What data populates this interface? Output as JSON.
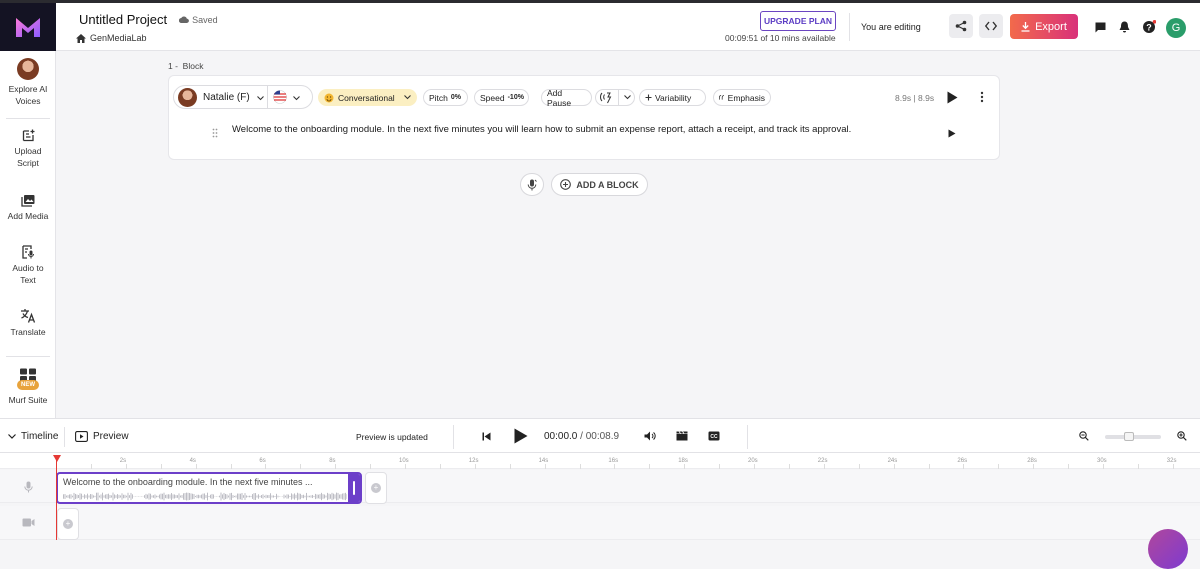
{
  "header": {
    "project_title": "Untitled Project",
    "saved_status": "Saved",
    "workspace": "GenMediaLab",
    "upgrade_label": "UPGRADE PLAN",
    "time_available": "00:09:51 of 10 mins available",
    "editing_status": "You are editing",
    "export_label": "Export",
    "user_initial": "G"
  },
  "sidebar": {
    "items": [
      {
        "label": "Explore AI Voices"
      },
      {
        "label": "Upload Script"
      },
      {
        "label": "Add Media"
      },
      {
        "label": "Audio to Text"
      },
      {
        "label": "Translate"
      },
      {
        "label": "Murf Suite",
        "badge": "NEW"
      }
    ]
  },
  "block": {
    "index": "1 -",
    "label": "Block",
    "voice": "Natalie (F)",
    "style": "Conversational",
    "pitch_label": "Pitch",
    "pitch_value": "0%",
    "speed_label": "Speed",
    "speed_value": "-10%",
    "add_pause": "Add Pause",
    "variability": "Variability",
    "emphasis": "Emphasis",
    "duration": "8.9s | 8.9s",
    "script_text": "Welcome to the onboarding module. In the next five minutes you will learn how to submit an expense report, attach a receipt, and track its approval."
  },
  "add_block_label": "ADD A BLOCK",
  "timeline": {
    "toggle_label": "Timeline",
    "preview_label": "Preview",
    "preview_status": "Preview is updated",
    "current_time": "00:00.0",
    "separator": " / ",
    "total_time": "00:08.9",
    "ticks": [
      "2s",
      "4s",
      "6s",
      "8s",
      "10s",
      "12s",
      "14s",
      "16s",
      "18s",
      "20s",
      "22s",
      "24s",
      "26s",
      "28s",
      "30s",
      "32s"
    ],
    "clip_text": "Welcome to the onboarding module. In the next five minutes ..."
  },
  "colors": {
    "accent": "#6c3fc9",
    "export_start": "#f26a4b",
    "export_end": "#d9317a",
    "style_pill": "#fbefc2",
    "playhead": "#e53935"
  }
}
